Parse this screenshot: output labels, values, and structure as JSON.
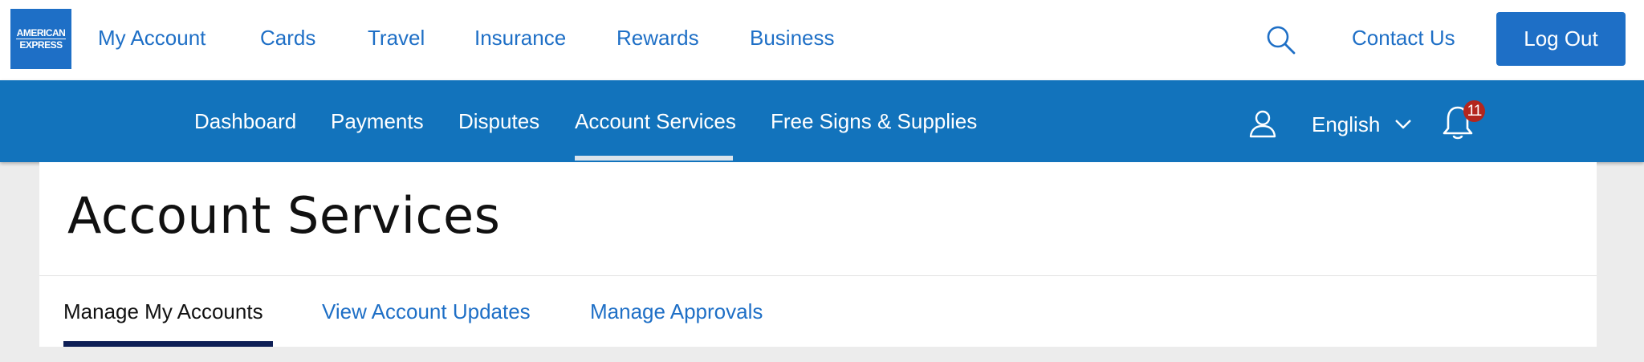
{
  "brand": {
    "logo_line1": "AMERICAN",
    "logo_line2": "EXPRESS"
  },
  "header": {
    "nav": [
      {
        "label": "My Account"
      },
      {
        "label": "Cards"
      },
      {
        "label": "Travel"
      },
      {
        "label": "Insurance"
      },
      {
        "label": "Rewards"
      },
      {
        "label": "Business"
      }
    ],
    "search_icon": "search-icon",
    "contact_label": "Contact Us",
    "logout_label": "Log Out"
  },
  "subnav": {
    "items": [
      {
        "label": "Dashboard"
      },
      {
        "label": "Payments"
      },
      {
        "label": "Disputes"
      },
      {
        "label": "Account Services"
      },
      {
        "label": "Free Signs & Supplies"
      }
    ],
    "active_item": "Account Services",
    "profile_icon": "user-icon",
    "language": "English",
    "notification_icon": "bell-icon",
    "notification_count": "11"
  },
  "main": {
    "title": "Account Services",
    "tabs": [
      {
        "label": "Manage My Accounts"
      },
      {
        "label": "View Account Updates"
      },
      {
        "label": "Manage Approvals"
      }
    ],
    "active_tab": "Manage My Accounts"
  },
  "colors": {
    "brand_blue": "#1e6fc6",
    "subnav_blue": "#1273bc",
    "active_tab_underline": "#0e1f56",
    "badge_red": "#b3261e",
    "page_background": "#ececec"
  }
}
